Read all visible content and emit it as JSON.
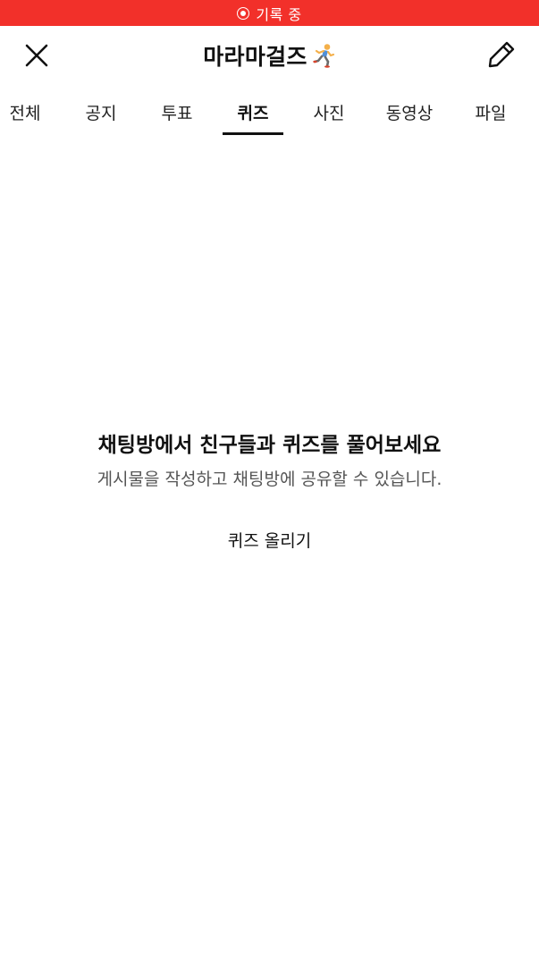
{
  "status_bar": {
    "recording_label": "기록 중"
  },
  "header": {
    "title": "마라마걸즈",
    "close_icon": "close-icon",
    "edit_icon": "pencil-icon",
    "title_emoji": "running-person-icon"
  },
  "tabs": [
    {
      "label": "전체"
    },
    {
      "label": "공지"
    },
    {
      "label": "투표"
    },
    {
      "label": "퀴즈",
      "active": true
    },
    {
      "label": "사진"
    },
    {
      "label": "동영상"
    },
    {
      "label": "파일"
    }
  ],
  "empty_state": {
    "title": "채팅방에서 친구들과 퀴즈를 풀어보세요",
    "subtitle": "게시물을 작성하고 채팅방에 공유할 수 있습니다.",
    "action_label": "퀴즈 올리기"
  },
  "colors": {
    "recording_bar": "#f2302a",
    "text_primary": "#111111",
    "text_secondary": "#555555",
    "background": "#ffffff"
  }
}
